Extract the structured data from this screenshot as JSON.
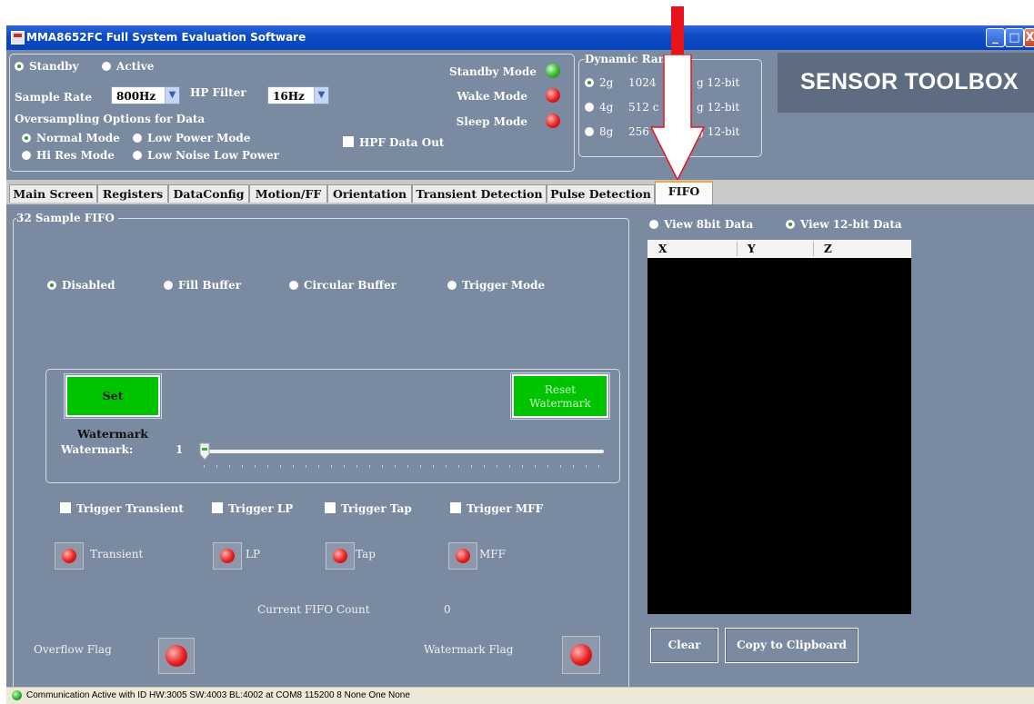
{
  "window": {
    "title": "MMA8652FC Full System Evaluation Software",
    "buttons": [
      "_",
      "□",
      "X"
    ]
  },
  "config": {
    "mode_options": [
      {
        "label": "Standby",
        "selected": true
      },
      {
        "label": "Active",
        "selected": false
      }
    ],
    "sample_rate_label": "Sample Rate",
    "sample_rate_value": "800Hz",
    "hp_filter_label": "HP Filter",
    "hp_filter_value": "16Hz",
    "oversampling_label": "Oversampling Options for Data",
    "oversampling_options": [
      {
        "label": "Normal Mode",
        "selected": true
      },
      {
        "label": "Low Power Mode",
        "selected": false
      },
      {
        "label": "Hi Res Mode",
        "selected": false
      },
      {
        "label": "Low Noise Low Power",
        "selected": false
      }
    ],
    "hpf_data_out_label": "HPF Data Out",
    "status_modes": [
      {
        "label": "Standby Mode",
        "color": "green"
      },
      {
        "label": "Wake Mode",
        "color": "red"
      },
      {
        "label": "Sleep Mode",
        "color": "red"
      }
    ]
  },
  "dynamic_range": {
    "title": "Dynamic Ran",
    "options": [
      {
        "g": "2g",
        "pre": "1024",
        "post": "g 12-bit",
        "selected": true
      },
      {
        "g": "4g",
        "pre": "512 c",
        "post": "g 12-bit",
        "selected": false
      },
      {
        "g": "8g",
        "pre": "256 co",
        "post": "s/g 12-bit",
        "selected": false
      }
    ]
  },
  "branding": {
    "text": "SENSOR TOOLBOX"
  },
  "tabs": [
    "Main Screen",
    "Registers",
    "DataConfig",
    "Motion/FF",
    "Orientation",
    "Transient Detection",
    "Pulse Detection",
    "FIFO"
  ],
  "active_tab": "FIFO",
  "fifo": {
    "group_title": "32 Sample FIFO",
    "modes": [
      {
        "label": "Disabled",
        "selected": true
      },
      {
        "label": "Fill Buffer",
        "selected": false
      },
      {
        "label": "Circular Buffer",
        "selected": false
      },
      {
        "label": "Trigger Mode",
        "selected": false
      }
    ],
    "set_watermark_label": "Set Watermark",
    "reset_watermark_line1": "Reset",
    "reset_watermark_line2": "Watermark",
    "watermark_label": "Watermark:",
    "watermark_value": "1",
    "triggers": [
      "Trigger Transient",
      "Trigger LP",
      "Trigger Tap",
      "Trigger MFF"
    ],
    "trigger_leds": [
      "Transient",
      "LP",
      "Tap",
      "MFF"
    ],
    "current_count_label": "Current FIFO Count",
    "current_count_value": "0",
    "overflow_flag_label": "Overflow Flag",
    "watermark_flag_label": "Watermark Flag"
  },
  "data_view": {
    "options": [
      {
        "label": "View 8bit Data",
        "selected": false
      },
      {
        "label": "View 12-bit Data",
        "selected": true
      }
    ],
    "columns": [
      "X",
      "Y",
      "Z"
    ],
    "clear_label": "Clear",
    "copy_label": "Copy to Clipboard"
  },
  "status_bar": {
    "text": "Communication Active with ID HW:3005 SW:4003 BL:4002 at COM8 115200 8 None One None"
  },
  "colors": {
    "panel": "#7a8aa0",
    "accent_green": "#00c400",
    "arrow": "#e8141c",
    "tab_highlight": "#f3a93a"
  }
}
